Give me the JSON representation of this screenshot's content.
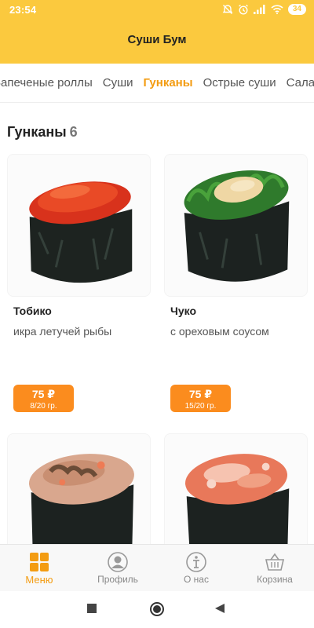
{
  "status_bar": {
    "time": "23:54",
    "battery": "34"
  },
  "header": {
    "title": "Суши Бум"
  },
  "tabs": [
    {
      "label": "Запеченые роллы",
      "active": false
    },
    {
      "label": "Суши",
      "active": false
    },
    {
      "label": "Гунканы",
      "active": true
    },
    {
      "label": "Острые суши",
      "active": false
    },
    {
      "label": "Салаты",
      "active": false
    }
  ],
  "section": {
    "title": "Гунканы",
    "count": "6"
  },
  "products": [
    {
      "name": "Тобико",
      "description": "икра летучей рыбы",
      "price": "75 ₽",
      "weight": "8/20 гр."
    },
    {
      "name": "Чуко",
      "description": "с ореховым соусом",
      "price": "75 ₽",
      "weight": "15/20 гр."
    },
    {
      "name": "",
      "description": "",
      "price": "",
      "weight": ""
    },
    {
      "name": "",
      "description": "",
      "price": "",
      "weight": ""
    }
  ],
  "bottom_nav": [
    {
      "label": "Меню",
      "icon": "menu-grid-icon",
      "active": true
    },
    {
      "label": "Профиль",
      "icon": "profile-icon",
      "active": false
    },
    {
      "label": "О нас",
      "icon": "about-icon",
      "active": false
    },
    {
      "label": "Корзина",
      "icon": "basket-icon",
      "active": false
    }
  ],
  "colors": {
    "header": "#fbc93e",
    "accent": "#f39c12",
    "price_badge": "#fb8c1e"
  }
}
